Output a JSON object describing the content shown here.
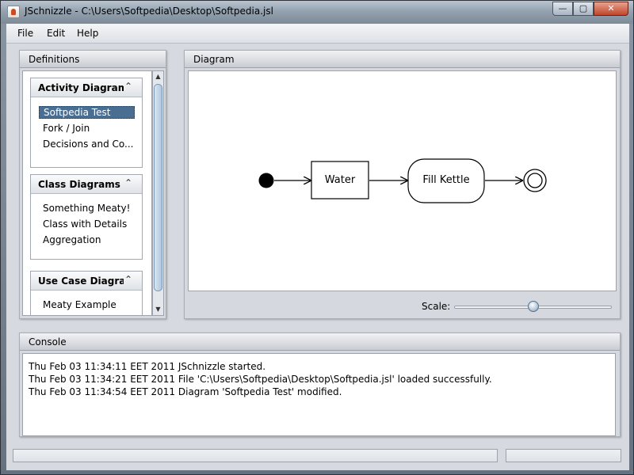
{
  "window": {
    "title": "JSchnizzle - C:\\Users\\Softpedia\\Desktop\\Softpedia.jsl"
  },
  "menu": [
    "File",
    "Edit",
    "Help"
  ],
  "definitions": {
    "title": "Definitions",
    "groups": [
      {
        "title": "Activity Diagrams",
        "items": [
          "Softpedia Test",
          "Fork / Join",
          "Decisions and Co..."
        ],
        "selected": "Softpedia Test"
      },
      {
        "title": "Class Diagrams",
        "items": [
          "Something Meaty!",
          "Class with Details",
          "Aggregation"
        ]
      },
      {
        "title": "Use Case Diagra...",
        "items": [
          "Meaty Example"
        ]
      }
    ]
  },
  "diagram": {
    "title": "Diagram",
    "nodes": {
      "action1": "Water",
      "action2": "Fill Kettle"
    },
    "scale_label": "Scale:",
    "scale_value": 0.5
  },
  "console": {
    "title": "Console",
    "lines": [
      "Thu Feb 03 11:34:11 EET 2011  JSchnizzle started.",
      "Thu Feb 03 11:34:21 EET 2011  File 'C:\\Users\\Softpedia\\Desktop\\Softpedia.jsl' loaded successfully.",
      "Thu Feb 03 11:34:54 EET 2011  Diagram 'Softpedia Test' modified."
    ]
  }
}
